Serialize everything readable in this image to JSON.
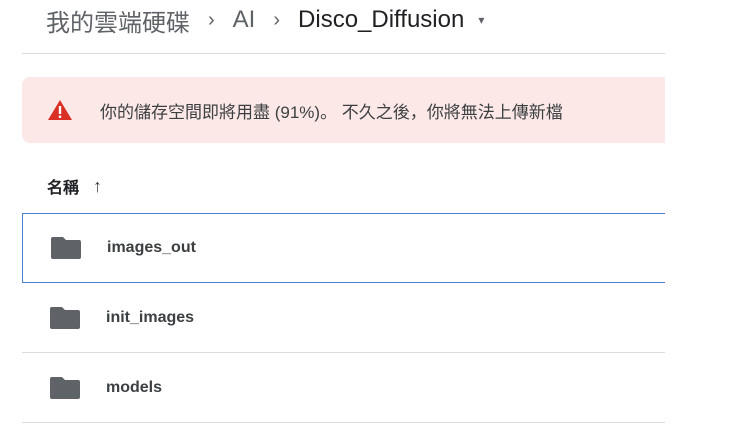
{
  "breadcrumb": {
    "root": "我的雲端硬碟",
    "items": [
      "AI",
      "Disco_Diffusion"
    ],
    "separator": "›",
    "caret": "▾"
  },
  "banner": {
    "message": "你的儲存空間即將用盡 (91%)。 不久之後，你將無法上傳新檔",
    "icon": "warning-icon",
    "color": "#d93025"
  },
  "list": {
    "header": "名稱",
    "sort_arrow": "↑",
    "files": [
      {
        "name": "images_out",
        "icon": "folder-icon",
        "selected": true
      },
      {
        "name": "init_images",
        "icon": "folder-icon"
      },
      {
        "name": "models",
        "icon": "folder-icon"
      }
    ]
  }
}
